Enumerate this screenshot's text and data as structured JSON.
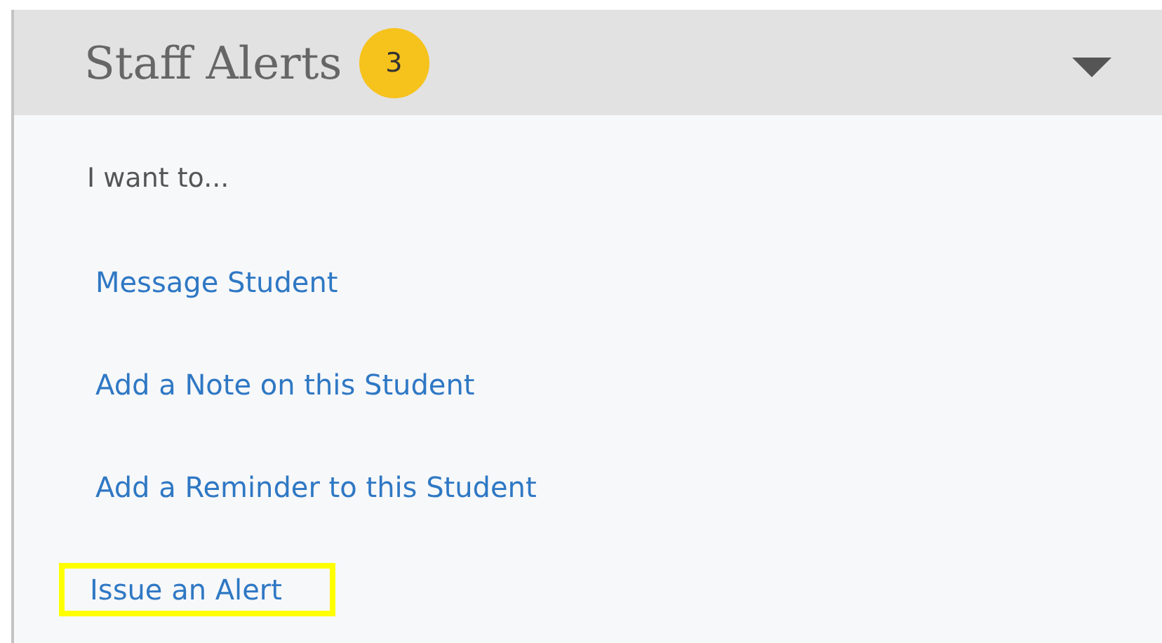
{
  "panel": {
    "title": "Staff Alerts",
    "badge": "3",
    "expanded": true
  },
  "prompt": "I want to...",
  "actions": [
    {
      "label": "Message Student",
      "highlighted": false
    },
    {
      "label": "Add a Note on this Student",
      "highlighted": false
    },
    {
      "label": "Add a Reminder to this Student",
      "highlighted": false
    },
    {
      "label": "Issue an Alert",
      "highlighted": true
    }
  ]
}
